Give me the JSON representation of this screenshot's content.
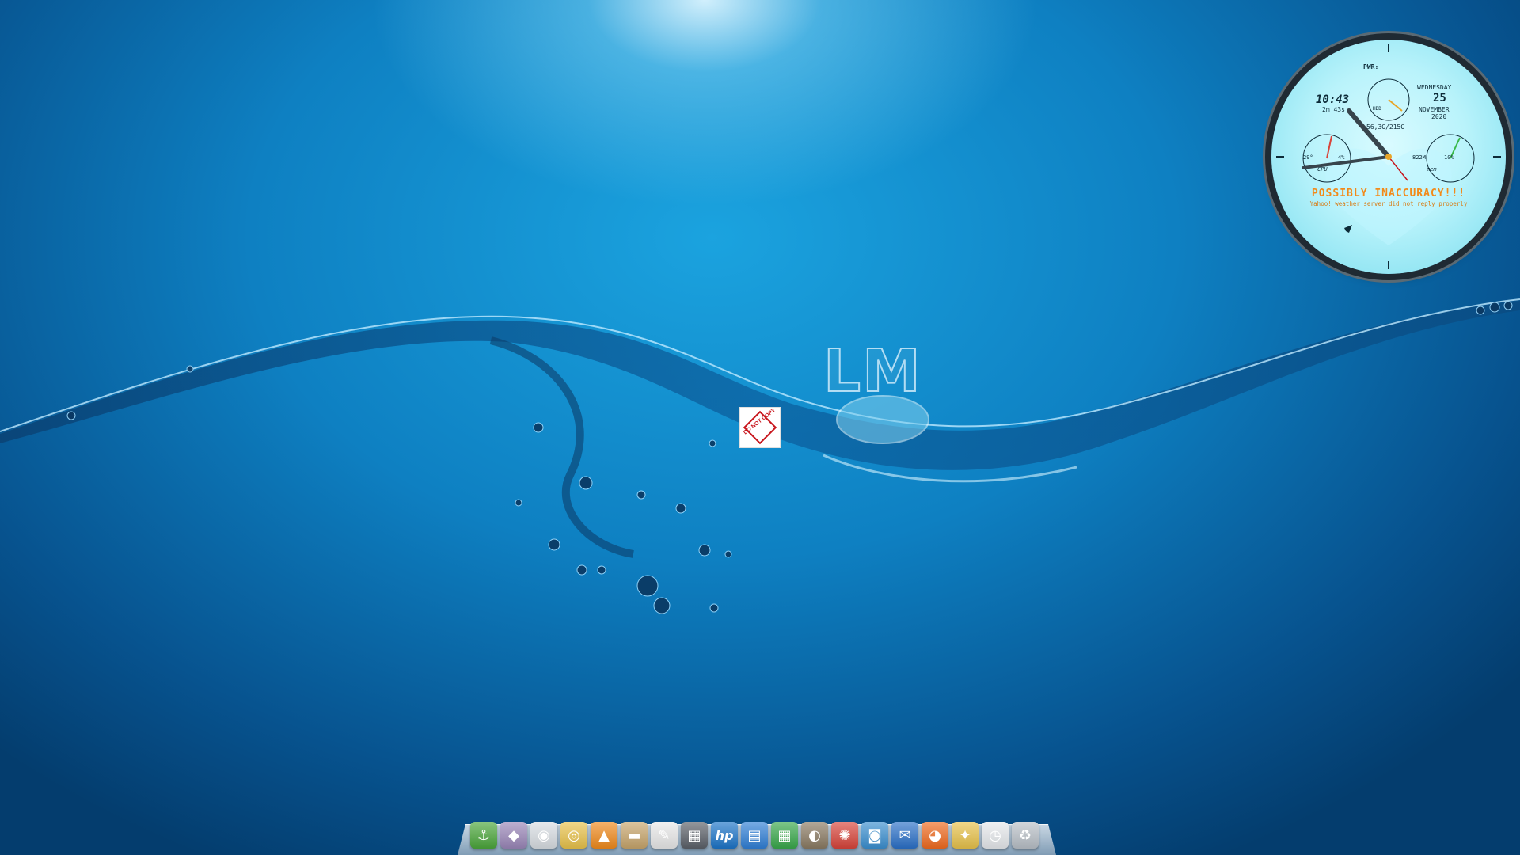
{
  "desktop": {
    "wallpaper_logo": "LM",
    "sticker_text": "DO NOT COPY"
  },
  "clock_widget": {
    "pwr_label": "PWR:",
    "time": "10:43",
    "uptime": "2m 43s",
    "day": "WEDNESDAY",
    "date": "25",
    "month": "NOVEMBER",
    "year": "2020",
    "hdd_label": "HDD",
    "disk_usage": "56,3G/215G",
    "cpu_label": "CPU",
    "cpu_temp": "29°",
    "cpu_percent": "4%",
    "mem_label": "mem",
    "mem_used": "822M",
    "mem_percent": "10%",
    "warning": "POSSIBLY INACCURACY!!!",
    "warning_sub": "Yahoo! weather server did not reply properly"
  },
  "dock": {
    "items": [
      {
        "name": "anchor-icon",
        "glyph": "⚓",
        "bg": "#4aa63a"
      },
      {
        "name": "vector-draw-icon",
        "glyph": "◆",
        "bg": "#9a86b8"
      },
      {
        "name": "disc-burner-icon",
        "glyph": "◉",
        "bg": "#d8dde2"
      },
      {
        "name": "speaker-icon",
        "glyph": "◎",
        "bg": "#e9c24a"
      },
      {
        "name": "vlc-cone-icon",
        "glyph": "▲",
        "bg": "#f08a1c"
      },
      {
        "name": "folder-icon",
        "glyph": "▬",
        "bg": "#c7a56b"
      },
      {
        "name": "text-editor-icon",
        "glyph": "✎",
        "bg": "#e8e8e8"
      },
      {
        "name": "calculator-icon",
        "glyph": "▦",
        "bg": "#5b6068"
      },
      {
        "name": "hp-printer-icon",
        "glyph": "hp",
        "bg": "#1b74c8"
      },
      {
        "name": "writer-document-icon",
        "glyph": "▤",
        "bg": "#2f7fd6"
      },
      {
        "name": "calc-spreadsheet-icon",
        "glyph": "▦",
        "bg": "#38a84a"
      },
      {
        "name": "gimp-icon",
        "glyph": "◐",
        "bg": "#8a7a62"
      },
      {
        "name": "color-wheel-icon",
        "glyph": "✺",
        "bg": "#d8443a"
      },
      {
        "name": "screenshot-icon",
        "glyph": "◙",
        "bg": "#3a8fd0"
      },
      {
        "name": "mail-client-icon",
        "glyph": "✉",
        "bg": "#2a70c8"
      },
      {
        "name": "firefox-icon",
        "glyph": "◕",
        "bg": "#f06a1e"
      },
      {
        "name": "file-manager-broom-icon",
        "glyph": "✦",
        "bg": "#e8c24a"
      },
      {
        "name": "clock-icon",
        "glyph": "◷",
        "bg": "#e6e9ec"
      },
      {
        "name": "trash-icon",
        "glyph": "♻",
        "bg": "#b9c0c7"
      }
    ]
  }
}
